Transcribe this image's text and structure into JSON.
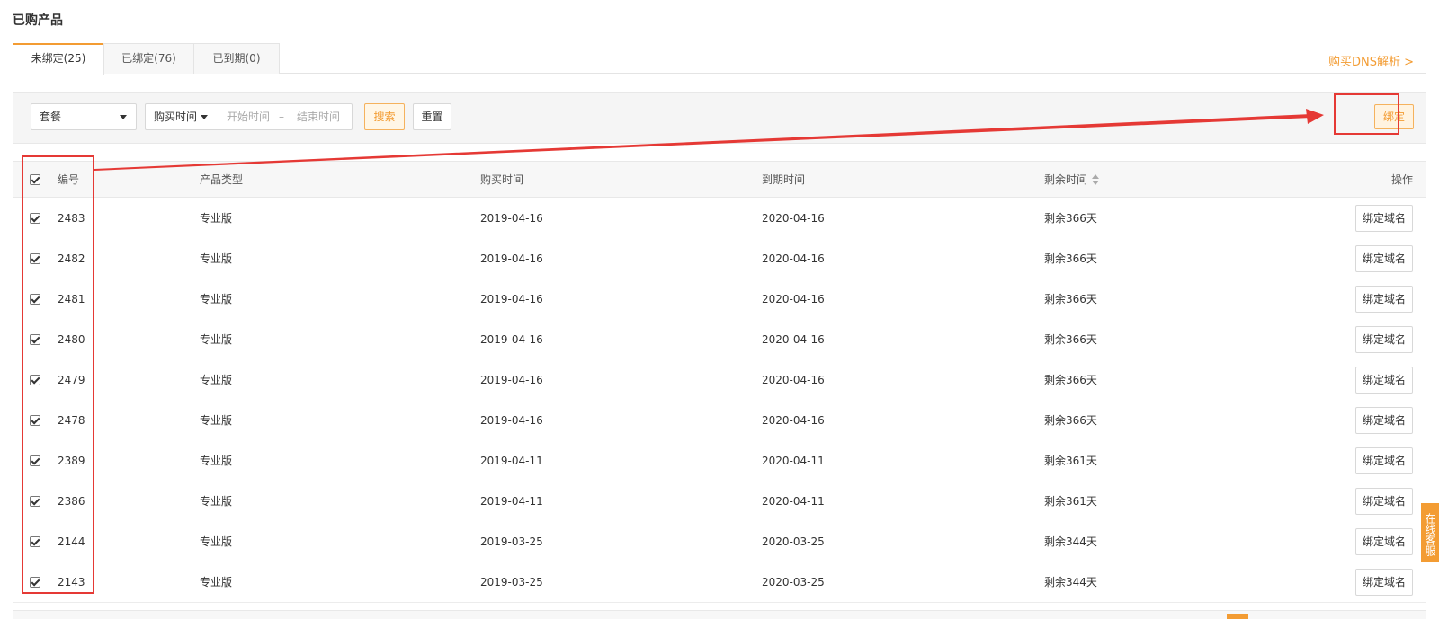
{
  "page": {
    "title": "已购产品"
  },
  "tabs": [
    {
      "label": "未绑定(25)"
    },
    {
      "label": "已绑定(76)"
    },
    {
      "label": "已到期(0)"
    }
  ],
  "buy_dns_link": "购买DNS解析 >",
  "filter": {
    "package_select": "套餐",
    "time_select": "购买时间",
    "start_placeholder": "开始时间",
    "range_separator": "–",
    "end_placeholder": "结束时间",
    "search_label": "搜索",
    "reset_label": "重置",
    "bind_label": "绑定"
  },
  "table": {
    "headers": {
      "id": "编号",
      "type": "产品类型",
      "buy_time": "购买时间",
      "expire_time": "到期时间",
      "remaining": "剩余时间",
      "action": "操作"
    },
    "action_label": "绑定域名",
    "rows": [
      {
        "id": "2483",
        "type": "专业版",
        "buy": "2019-04-16",
        "expire": "2020-04-16",
        "remaining": "剩余366天"
      },
      {
        "id": "2482",
        "type": "专业版",
        "buy": "2019-04-16",
        "expire": "2020-04-16",
        "remaining": "剩余366天"
      },
      {
        "id": "2481",
        "type": "专业版",
        "buy": "2019-04-16",
        "expire": "2020-04-16",
        "remaining": "剩余366天"
      },
      {
        "id": "2480",
        "type": "专业版",
        "buy": "2019-04-16",
        "expire": "2020-04-16",
        "remaining": "剩余366天"
      },
      {
        "id": "2479",
        "type": "专业版",
        "buy": "2019-04-16",
        "expire": "2020-04-16",
        "remaining": "剩余366天"
      },
      {
        "id": "2478",
        "type": "专业版",
        "buy": "2019-04-16",
        "expire": "2020-04-16",
        "remaining": "剩余366天"
      },
      {
        "id": "2389",
        "type": "专业版",
        "buy": "2019-04-11",
        "expire": "2020-04-11",
        "remaining": "剩余361天"
      },
      {
        "id": "2386",
        "type": "专业版",
        "buy": "2019-04-11",
        "expire": "2020-04-11",
        "remaining": "剩余361天"
      },
      {
        "id": "2144",
        "type": "专业版",
        "buy": "2019-03-25",
        "expire": "2020-03-25",
        "remaining": "剩余344天"
      },
      {
        "id": "2143",
        "type": "专业版",
        "buy": "2019-03-25",
        "expire": "2020-03-25",
        "remaining": "剩余344天"
      }
    ]
  },
  "support_tab": "在线客服",
  "colors": {
    "accent": "#f39c33",
    "annotation": "#e53935"
  }
}
